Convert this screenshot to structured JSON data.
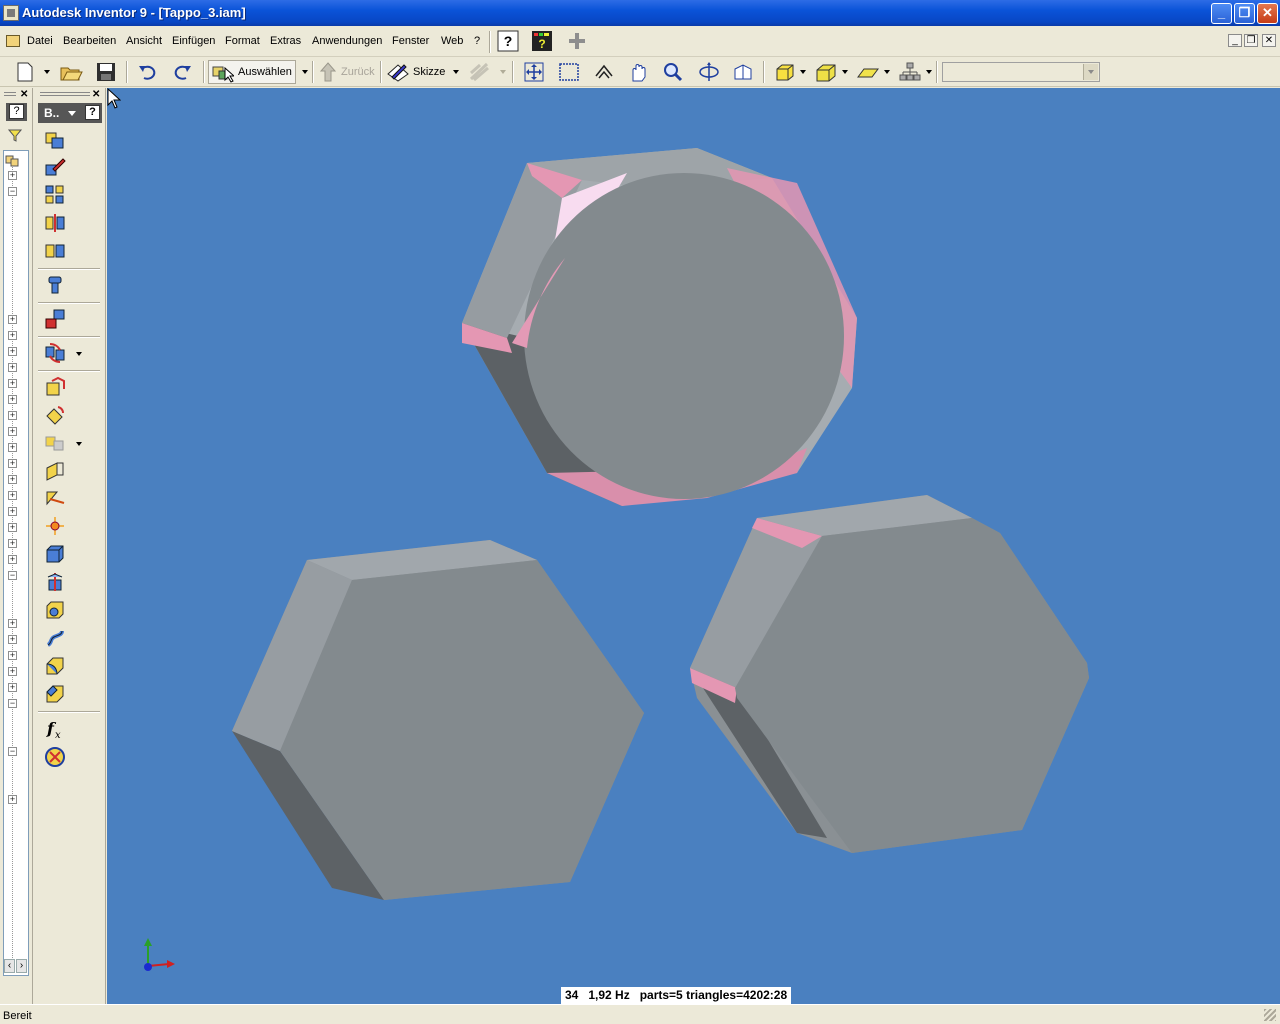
{
  "window": {
    "title": "Autodesk Inventor 9 - [Tappo_3.iam]",
    "minimize_icon": "minimize-icon",
    "restore_icon": "restore-icon",
    "close_icon": "close-icon"
  },
  "menu": {
    "items": [
      {
        "label": "Datei",
        "accel": "D"
      },
      {
        "label": "Bearbeiten",
        "accel": "B"
      },
      {
        "label": "Ansicht",
        "accel": "A"
      },
      {
        "label": "Einfügen",
        "accel": "E"
      },
      {
        "label": "Format",
        "accel": "F"
      },
      {
        "label": "Extras",
        "accel": "x"
      },
      {
        "label": "Anwendungen",
        "accel": "n"
      },
      {
        "label": "Fenster",
        "accel": "F"
      },
      {
        "label": "Web",
        "accel": "W"
      },
      {
        "label": "?",
        "accel": "?"
      }
    ]
  },
  "toolbar": {
    "select_label": "Auswählen",
    "back_label": "Zurück",
    "sketch_label": "Skizze",
    "combo_value": ""
  },
  "panel": {
    "header_label": "B..",
    "help": "?"
  },
  "browser": {
    "help": "?"
  },
  "viewport": {
    "stats": "34   1,92 Hz   parts=5 triangles=4202:28",
    "background": "#4a80c0"
  },
  "status": {
    "text": "Bereit"
  },
  "colors": {
    "title_bar": "#0a53d8",
    "chrome": "#ece9d8",
    "part_face": "#838a8e",
    "part_side_light": "#a3a9ae",
    "part_side_dark": "#5e6367",
    "highlight": "#e497b3"
  }
}
